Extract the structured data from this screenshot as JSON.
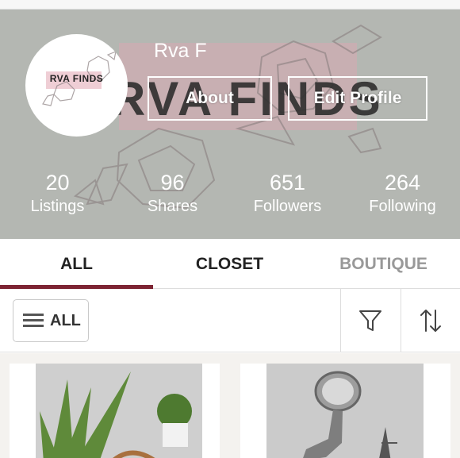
{
  "profile": {
    "display_name": "Rva F",
    "avatar_text": "RVA FINDS",
    "cover_text": "RVA FINDS",
    "about_button": "About",
    "edit_button": "Edit Profile"
  },
  "stats": [
    {
      "value": "20",
      "label": "Listings"
    },
    {
      "value": "96",
      "label": "Shares"
    },
    {
      "value": "651",
      "label": "Followers"
    },
    {
      "value": "264",
      "label": "Following"
    }
  ],
  "tabs": [
    {
      "label": "ALL",
      "active": true
    },
    {
      "label": "CLOSET",
      "active": false
    },
    {
      "label": "BOUTIQUE",
      "active": false
    }
  ],
  "filter": {
    "all_label": "ALL",
    "filter_icon": "filter-icon",
    "sort_icon": "sort-icon"
  },
  "colors": {
    "accent": "#7d2433",
    "cover_bg": "#b4b7b2",
    "muted_tab": "#999999"
  }
}
